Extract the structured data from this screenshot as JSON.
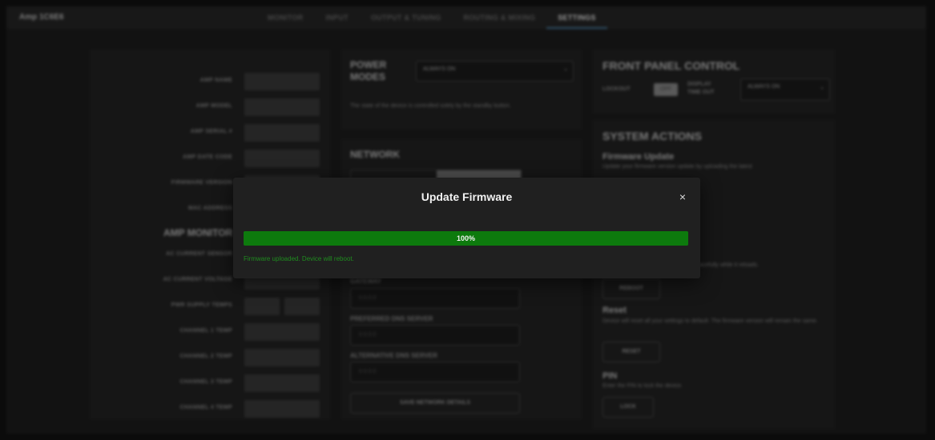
{
  "app": {
    "title": "Amp 1C6E6"
  },
  "tabs": [
    {
      "label": "MONITOR"
    },
    {
      "label": "INPUT"
    },
    {
      "label": "OUTPUT & TUNING"
    },
    {
      "label": "ROUTING & MIXING"
    },
    {
      "label": "SETTINGS"
    }
  ],
  "active_tab": "SETTINGS",
  "info": {
    "labels": [
      "AMP NAME",
      "AMP MODEL",
      "AMP SERIAL #",
      "AMP DATE CODE",
      "FIRMWARE VERSION",
      "MAC ADDRESS"
    ],
    "monitor_title": "AMP MONITOR",
    "monitor_labels": [
      "AC CURRENT SENSOR",
      "AC CURRENT VOLTAGE",
      "PWR SUPPLY TEMPS",
      "CHANNEL 1 TEMP",
      "CHANNEL 2 TEMP",
      "CHANNEL 3 TEMP",
      "CHANNEL 4 TEMP"
    ]
  },
  "power": {
    "title_line1": "POWER",
    "title_line2": "MODES",
    "selected": "ALWAYS ON",
    "description": "The state of the device is controlled solely by the standby button."
  },
  "network": {
    "title": "NETWORK",
    "fields": [
      {
        "label": "GATEWAY",
        "placeholder": "0.0.0.0"
      },
      {
        "label": "PREFERRED DNS SERVER",
        "placeholder": "0.0.0.0"
      },
      {
        "label": "ALTERNATIVE DNS SERVER",
        "placeholder": "0.0.0.0"
      }
    ],
    "save_label": "SAVE NETWORK DETAILS"
  },
  "front_panel": {
    "title": "FRONT PANEL CONTROL",
    "lockout_label": "LOCKOUT",
    "lockout_value": "OFF",
    "display_timeout_line1": "DISPLAY",
    "display_timeout_line2": "TIME OUT",
    "timeout_selected": "ALWAYS ON"
  },
  "system": {
    "title": "SYSTEM ACTIONS",
    "firmware_title": "Firmware Update",
    "firmware_desc": "Update your firmware version update by uploading the latest",
    "reboot_desc": "Device will reboot gracefully while it reloads.",
    "reboot_label": "REBOOT",
    "reset_title": "Reset",
    "reset_desc": "Device will reset all your settings to default. The firmware version will remain the same.",
    "reset_label": "RESET",
    "pin_title": "PIN",
    "pin_desc": "Enter the PIN to lock the device.",
    "lock_label": "LOCK"
  },
  "modal": {
    "title": "Update Firmware",
    "close": "×",
    "progress_fraction": 1.0,
    "progress_text": "100%",
    "status": "Firmware uploaded. Device will reboot.",
    "progress_color": "#0d7a0d",
    "status_color": "#1f8c1f"
  }
}
